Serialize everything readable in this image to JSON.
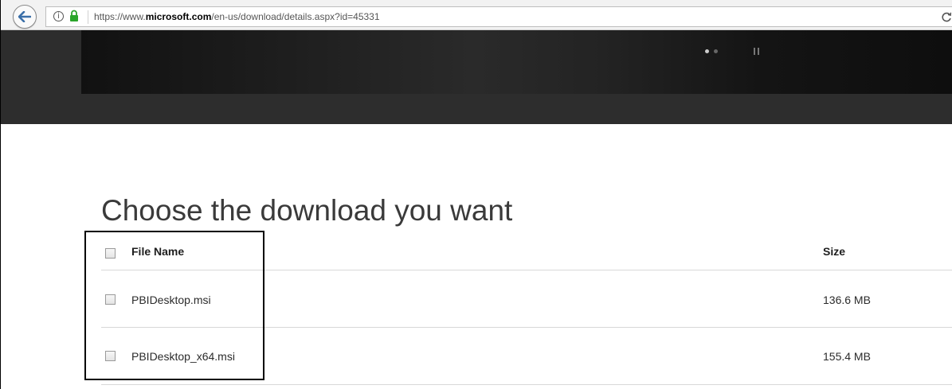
{
  "browser": {
    "url_prefix": "https://www.",
    "url_domain": "microsoft.com",
    "url_path": "/en-us/download/details.aspx?id=45331"
  },
  "page": {
    "title": "Choose the download you want"
  },
  "table": {
    "header": {
      "name": "File Name",
      "size": "Size"
    },
    "rows": [
      {
        "name": "PBIDesktop.msi",
        "size": "136.6 MB"
      },
      {
        "name": "PBIDesktop_x64.msi",
        "size": "155.4 MB"
      }
    ]
  },
  "colors": {
    "hero_background": "#2d2d2d",
    "hero_dot_active": "#cccccc",
    "hero_dot_inactive": "#666666",
    "lock_green": "#2aa52a"
  }
}
